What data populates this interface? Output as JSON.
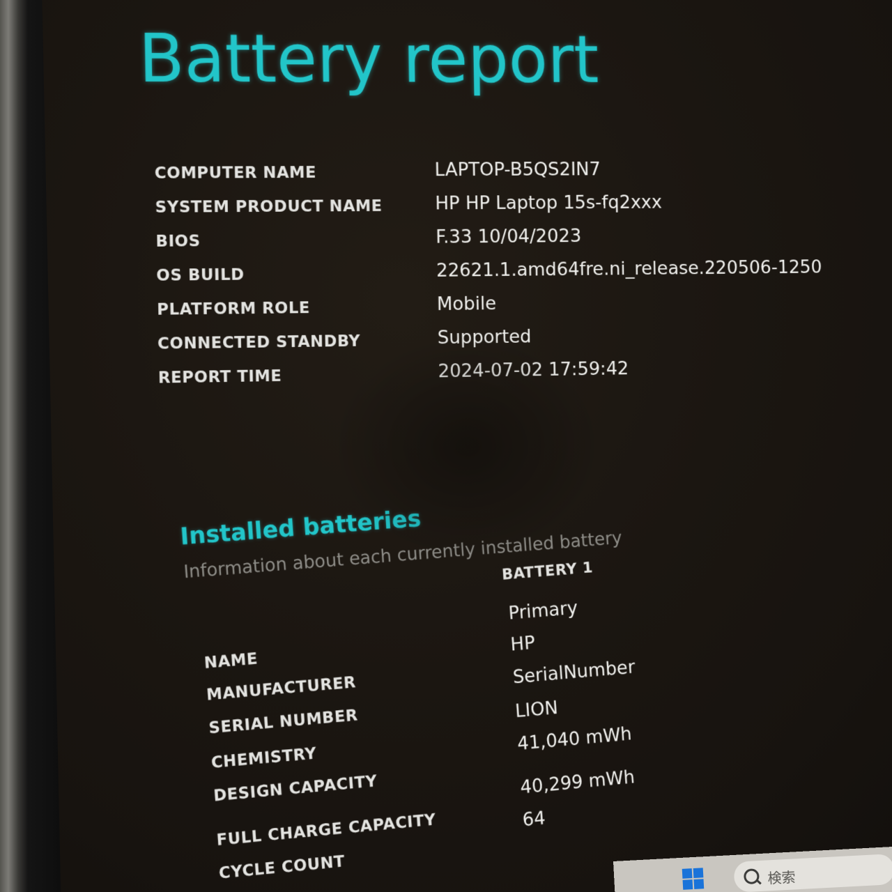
{
  "report": {
    "title": "Battery report",
    "system_info": [
      {
        "label": "COMPUTER NAME",
        "value": "LAPTOP-B5QS2IN7"
      },
      {
        "label": "SYSTEM PRODUCT NAME",
        "value": "HP HP Laptop 15s-fq2xxx"
      },
      {
        "label": "BIOS",
        "value": "F.33 10/04/2023"
      },
      {
        "label": "OS BUILD",
        "value": "22621.1.amd64fre.ni_release.220506-1250"
      },
      {
        "label": "PLATFORM ROLE",
        "value": "Mobile"
      },
      {
        "label": "CONNECTED STANDBY",
        "value": "Supported"
      },
      {
        "label": "REPORT TIME",
        "value": "2024-07-02  17:59:42"
      }
    ]
  },
  "installed_batteries": {
    "title": "Installed batteries",
    "subtitle": "Information about each currently installed battery",
    "battery_header": "BATTERY 1",
    "rows": [
      {
        "label": "NAME",
        "value": "Primary"
      },
      {
        "label": "MANUFACTURER",
        "value": "HP"
      },
      {
        "label": "SERIAL NUMBER",
        "value": "SerialNumber"
      },
      {
        "label": "CHEMISTRY",
        "value": "LION"
      },
      {
        "label": "DESIGN CAPACITY",
        "value": "41,040 mWh"
      },
      {
        "label": "FULL CHARGE CAPACITY",
        "value": "40,299 mWh"
      },
      {
        "label": "CYCLE COUNT",
        "value": "64"
      }
    ]
  },
  "taskbar": {
    "start_icon": "windows-logo-icon",
    "search_icon": "search-icon",
    "search_placeholder": "検索"
  },
  "colors": {
    "accent": "#22c5c9",
    "background": "#1b1611",
    "text": "#efefec",
    "muted": "#8d8c87"
  }
}
